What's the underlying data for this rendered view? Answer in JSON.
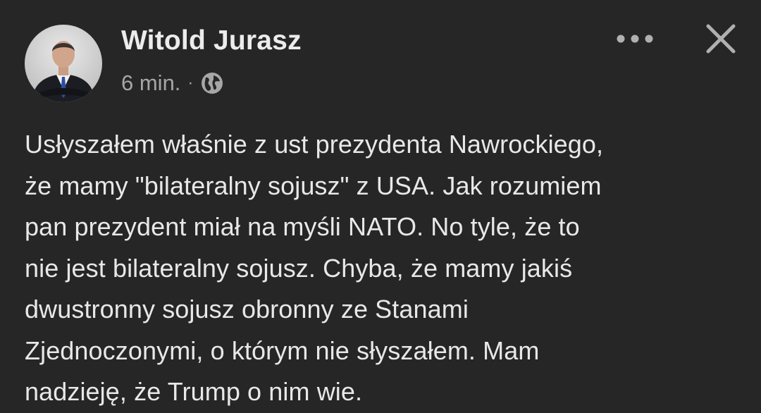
{
  "post": {
    "author": {
      "name": "Witold Jurasz",
      "avatar_icon": "profile-photo"
    },
    "timestamp": "6 min.",
    "separator": "·",
    "audience_icon": "globe-icon",
    "more_icon": "more-options-icon",
    "close_icon": "close-icon",
    "text_lines": [
      "Usłyszałem właśnie z ust prezydenta Nawrockiego,",
      "że mamy \"bilateralny sojusz\" z USA. Jak rozumiem",
      "pan prezydent miał na myśli NATO. No tyle, że to",
      "nie jest bilateralny sojusz. Chyba, że mamy jakiś",
      "dwustronny sojusz obronny ze Stanami",
      "Zjednoczonymi, o którym nie słyszałem. Mam",
      "nadzieję, że Trump o nim wie."
    ]
  },
  "colors": {
    "background": "#262626",
    "text": "#e8e8e8",
    "secondary_text": "#a6a6a6",
    "icon": "#b0b0b0"
  }
}
